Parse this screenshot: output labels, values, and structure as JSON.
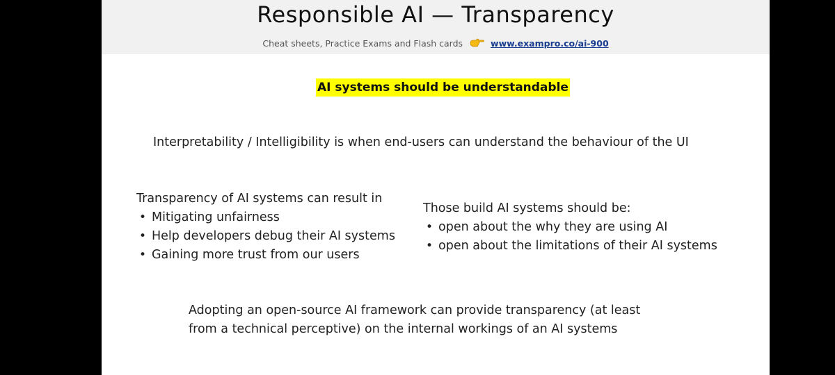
{
  "header": {
    "title": "Responsible AI — Transparency",
    "subtitle": "Cheat sheets, Practice Exams and Flash cards",
    "link": "www.exampro.co/ai-900"
  },
  "highlight": "AI systems should be understandable",
  "definition": "Interpretability / Intelligibility is when end-users can understand the behaviour of the UI",
  "left_block": {
    "heading": "Transparency of AI systems can result in",
    "items": [
      "Mitigating unfairness",
      "Help developers debug their AI systems",
      "Gaining more trust from our users"
    ]
  },
  "right_block": {
    "heading": "Those build AI systems should be:",
    "items": [
      "open about the why they are using AI",
      "open about the limitations of their AI systems"
    ]
  },
  "closing": {
    "line1": "Adopting an open-source AI framework can provide transparency (at least",
    "line2": "from a technical perceptive) on the internal workings of an AI systems"
  },
  "bullet_char": "•",
  "colors": {
    "highlight": "#ffff00",
    "link": "#1a3d8f",
    "header_bg": "#f1f1f1"
  }
}
